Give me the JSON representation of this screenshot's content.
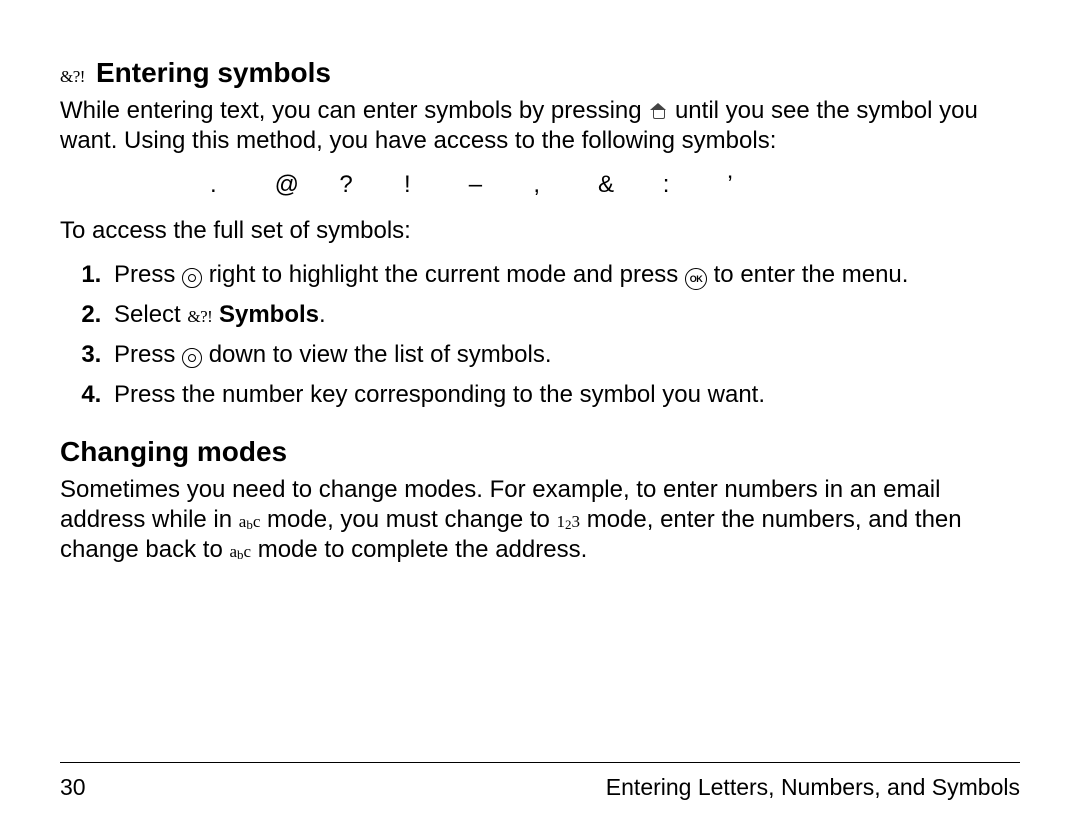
{
  "section1": {
    "iconTitle": "&?!",
    "title": "Entering symbols",
    "intro_a": "While entering text, you can enter symbols by pressing ",
    "intro_b": " until you see the symbol you want. Using this method, you have access to the following symbols:",
    "symbols": [
      ".",
      "@",
      "?",
      "!",
      "–",
      ",",
      "&",
      ":",
      "’"
    ],
    "access_line": "To access the full set of symbols:",
    "steps": {
      "s1a": "Press ",
      "s1b": " right to highlight the current mode and press ",
      "s1c": " to enter the menu.",
      "s2a": "Select ",
      "s2_icon": "&?!",
      "s2b": "Symbols",
      "s2c": ".",
      "s3a": "Press ",
      "s3b": " down to view the list of symbols.",
      "s4": "Press the number key corresponding to the symbol you want."
    }
  },
  "section2": {
    "title": "Changing modes",
    "body_a": "Sometimes you need to change modes. For example, to enter numbers in an email address while in ",
    "body_b": " mode, you must change to ",
    "body_c": " mode, enter the numbers, and then change back to ",
    "body_d": " mode to complete the address."
  },
  "icons": {
    "abc": {
      "a": "a",
      "b": "b",
      "c": "c"
    },
    "num": {
      "n1": "1",
      "n2": "2",
      "n3": "3"
    },
    "ok": "OK"
  },
  "footer": {
    "page": "30",
    "chapter": "Entering Letters, Numbers, and Symbols"
  }
}
